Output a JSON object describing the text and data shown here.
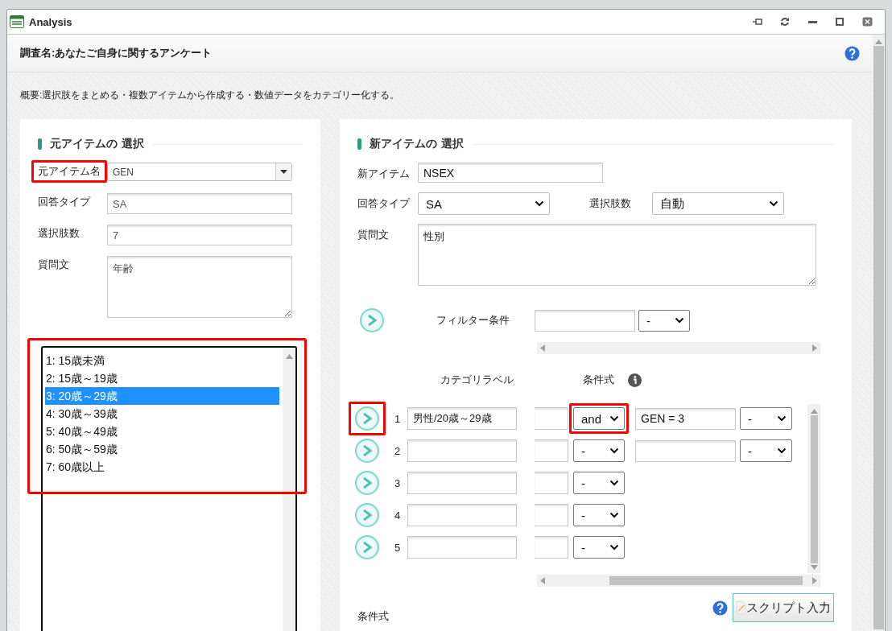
{
  "window": {
    "title": "Analysis"
  },
  "survey_title": "調査名:あなたご自身に関するアンケート",
  "summary": "概要:選択肢をまとめる・複数アイテムから作成する・数値データをカテゴリー化する。",
  "source": {
    "heading": "元アイテムの 選択",
    "fields": [
      {
        "label": "元アイテム名",
        "value": "GEN",
        "kind": "dropdown",
        "highlighted": true
      },
      {
        "label": "回答タイプ",
        "value": "SA",
        "kind": "text"
      },
      {
        "label": "選択肢数",
        "value": "7",
        "kind": "text"
      },
      {
        "label": "質問文",
        "value": "年齢",
        "kind": "textarea"
      }
    ],
    "choices_highlighted": true,
    "choices": [
      {
        "label": "1: 15歳未満",
        "selected": false
      },
      {
        "label": "2: 15歳～19歳",
        "selected": false
      },
      {
        "label": "3: 20歳～29歳",
        "selected": true
      },
      {
        "label": "4: 30歳～39歳",
        "selected": false
      },
      {
        "label": "5: 40歳～49歳",
        "selected": false
      },
      {
        "label": "6: 50歳～59歳",
        "selected": false
      },
      {
        "label": "7: 60歳以上",
        "selected": false
      }
    ]
  },
  "target": {
    "heading": "新アイテムの 選択",
    "item": {
      "label": "新アイテム",
      "value": "NSEX"
    },
    "answer_type": {
      "label": "回答タイプ",
      "value": "SA"
    },
    "choice_count": {
      "label": "選択肢数",
      "value": "自動"
    },
    "question": {
      "label": "質問文",
      "value": "性別"
    },
    "filter": {
      "label": "フィルター条件",
      "operator": "-"
    },
    "columns": [
      "カテゴリラベル",
      "条件式"
    ],
    "categories": [
      {
        "number": "1",
        "label": "男性/20歳～29歳",
        "arrow_highlighted": true,
        "connector": "and",
        "connector_highlighted": true,
        "kind": "extended",
        "expression": "GEN = 3",
        "operator": "-"
      },
      {
        "number": "2",
        "connector": "-",
        "kind": "extended",
        "operator": "-"
      },
      {
        "number": "3",
        "connector": "-",
        "kind": "basic"
      },
      {
        "number": "4",
        "connector": "-",
        "kind": "basic"
      },
      {
        "number": "5",
        "connector": "-",
        "kind": "basic"
      }
    ],
    "expression_label": "条件式",
    "script_button": "スクリプト入力"
  }
}
